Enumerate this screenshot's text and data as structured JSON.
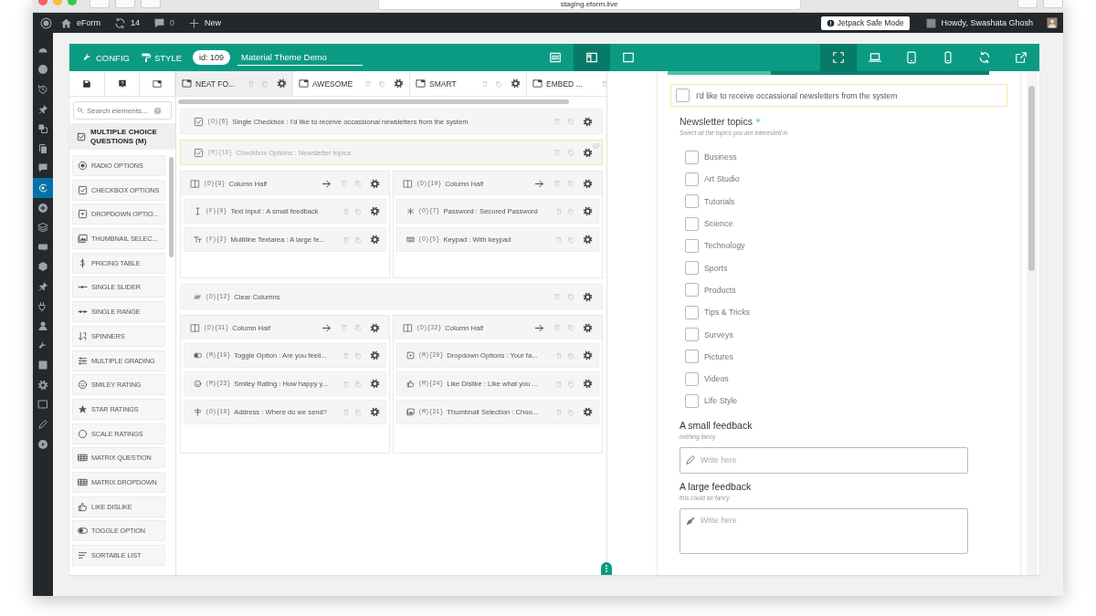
{
  "browser": {
    "url": "staging.eform.live"
  },
  "admin_bar": {
    "site": "eForm",
    "updates": "14",
    "comments": "0",
    "new": "New",
    "safe_mode": "Jetpack Safe Mode",
    "greeting": "Howdy, Swashata Ghosh"
  },
  "admin_menu": [
    {
      "kind": "gauge",
      "selected": false
    },
    {
      "kind": "jetpack",
      "selected": false
    },
    {
      "kind": "history",
      "selected": false
    },
    {
      "kind": "pin",
      "selected": false
    },
    {
      "kind": "media",
      "selected": false
    },
    {
      "kind": "pages",
      "selected": false
    },
    {
      "kind": "comment",
      "selected": false
    },
    {
      "kind": "eform",
      "selected": true
    },
    {
      "kind": "pluscircle",
      "selected": false
    },
    {
      "kind": "layers",
      "selected": false
    },
    {
      "kind": "woo",
      "selected": false
    },
    {
      "kind": "cube",
      "selected": false
    },
    {
      "kind": "pin",
      "selected": false
    },
    {
      "kind": "plug",
      "selected": false
    },
    {
      "kind": "user",
      "selected": false
    },
    {
      "kind": "wrench",
      "selected": false
    },
    {
      "kind": "settingsbox",
      "selected": false
    },
    {
      "kind": "gear",
      "selected": false
    },
    {
      "kind": "square",
      "selected": false
    },
    {
      "kind": "pencil",
      "selected": false
    },
    {
      "kind": "play",
      "selected": false
    }
  ],
  "toolbar": {
    "config": "CONFIG",
    "style": "STYLE",
    "form_id": "id: 109",
    "form_title": "Material Theme Demo",
    "layouts": [
      {
        "kind": "list",
        "selected": false
      },
      {
        "kind": "split",
        "selected": true
      },
      {
        "kind": "square",
        "selected": false
      }
    ],
    "devices": [
      {
        "kind": "expand",
        "selected": true
      },
      {
        "kind": "laptop",
        "selected": false
      },
      {
        "kind": "tablet",
        "selected": false
      },
      {
        "kind": "phone",
        "selected": false
      }
    ]
  },
  "palette": {
    "tabs": [
      {
        "kind": "save"
      },
      {
        "kind": "help"
      },
      {
        "kind": "fullscreen"
      }
    ],
    "search_placeholder": "Search elements...",
    "group": "MULTIPLE CHOICE QUESTIONS (M)",
    "items": [
      {
        "kind": "radio",
        "label": "RADIO OPTIONS"
      },
      {
        "kind": "check",
        "label": "CHECKBOX OPTIONS"
      },
      {
        "kind": "dropdown",
        "label": "DROPDOWN OPTIO..."
      },
      {
        "kind": "images",
        "label": "THUMBNAIL SELEC..."
      },
      {
        "kind": "dollar",
        "label": "PRICING TABLE"
      },
      {
        "kind": "slider",
        "label": "SINGLE SLIDER"
      },
      {
        "kind": "range",
        "label": "SINGLE RANGE"
      },
      {
        "kind": "spinner",
        "label": "SPINNERS"
      },
      {
        "kind": "grading",
        "label": "MULTIPLE GRADING"
      },
      {
        "kind": "smiley",
        "label": "SMILEY RATING"
      },
      {
        "kind": "star",
        "label": "STAR RATINGS"
      },
      {
        "kind": "circle",
        "label": "SCALE RATINGS"
      },
      {
        "kind": "table",
        "label": "MATRIX QUESTION"
      },
      {
        "kind": "table",
        "label": "MATRIX DROPDOWN"
      },
      {
        "kind": "thumb",
        "label": "LIKE DISLIKE"
      },
      {
        "kind": "toggle",
        "label": "TOGGLE OPTION"
      },
      {
        "kind": "sortlist",
        "label": "SORTABLE LIST"
      }
    ]
  },
  "builder": {
    "tabs": [
      {
        "label": "NEAT FO...",
        "selected": true
      },
      {
        "label": "AWESOME",
        "selected": false
      },
      {
        "label": "SMART",
        "selected": false
      },
      {
        "label": "EMBED ...",
        "selected": false
      }
    ],
    "elements": [
      {
        "kind": "check",
        "code": "(O){6}",
        "label": "Single Checkbox : I'd like to receive occassional newsletters from the system",
        "hidden": false
      },
      {
        "kind": "check",
        "code": "(M){18}",
        "label": "Checkbox Options : Newsletter topics",
        "hidden": true
      },
      {
        "kind": "columns",
        "columns": [
          {
            "code": "(D){9}",
            "label": "Column Half",
            "children": [
              {
                "kind": "cursor",
                "code": "(F){0}",
                "label": "Text Input : A small feedback"
              },
              {
                "kind": "textsize",
                "code": "(F){2}",
                "label": "Multiline Textarea : A large fe..."
              }
            ]
          },
          {
            "code": "(D){10}",
            "label": "Column Half",
            "children": [
              {
                "kind": "asterisk",
                "code": "(O){7}",
                "label": "Password : Secured Password"
              },
              {
                "kind": "keyboard",
                "code": "(O){5}",
                "label": "Keypad : With keypad"
              }
            ]
          }
        ]
      },
      {
        "kind": "clear",
        "code": "(D){12}",
        "label": "Clear Columns",
        "hidden": false
      },
      {
        "kind": "columns",
        "columns": [
          {
            "code": "(D){31}",
            "label": "Column Half",
            "children": [
              {
                "kind": "toggle",
                "code": "(M){19}",
                "label": "Toggle Option : Are you feeli..."
              },
              {
                "kind": "smiley",
                "code": "(M){23}",
                "label": "Smiley Rating : How happy y..."
              },
              {
                "kind": "signpost",
                "code": "(O){10}",
                "label": "Address : Where do we send?"
              }
            ]
          },
          {
            "code": "(D){32}",
            "label": "Column Half",
            "children": [
              {
                "kind": "dropdown",
                "code": "(M){20}",
                "label": "Dropdown Options : Your fa..."
              },
              {
                "kind": "thumb",
                "code": "(M){24}",
                "label": "Like Dislike : Like what you ..."
              },
              {
                "kind": "images",
                "code": "(M){21}",
                "label": "Thumbnail Selection : Choo..."
              }
            ]
          }
        ]
      }
    ]
  },
  "preview": {
    "progress": {
      "level": 0.32
    },
    "single_checkbox": {
      "label": "I'd like to receive occassional newsletters from the system",
      "checked": false
    },
    "group": {
      "title": "Newsletter topics",
      "required": true,
      "hint": "Select all the topics you are interested in",
      "options": [
        {
          "label": "Business",
          "checked": false
        },
        {
          "label": "Art Studio",
          "checked": false
        },
        {
          "label": "Tutorials",
          "checked": false
        },
        {
          "label": "Science",
          "checked": false
        },
        {
          "label": "Technology",
          "checked": false
        },
        {
          "label": "Sports",
          "checked": false
        },
        {
          "label": "Products",
          "checked": false
        },
        {
          "label": "Tips & Tricks",
          "checked": false
        },
        {
          "label": "Surveys",
          "checked": false
        },
        {
          "label": "Pictures",
          "checked": false
        },
        {
          "label": "Videos",
          "checked": false
        },
        {
          "label": "Life Style",
          "checked": false
        }
      ]
    },
    "fields": [
      {
        "kind": "input",
        "label": "A small feedback",
        "hint": "nothing fancy",
        "placeholder": "Write here"
      },
      {
        "kind": "textarea",
        "label": "A large feedback",
        "hint": "this could be fancy",
        "placeholder": "Write here"
      }
    ]
  }
}
